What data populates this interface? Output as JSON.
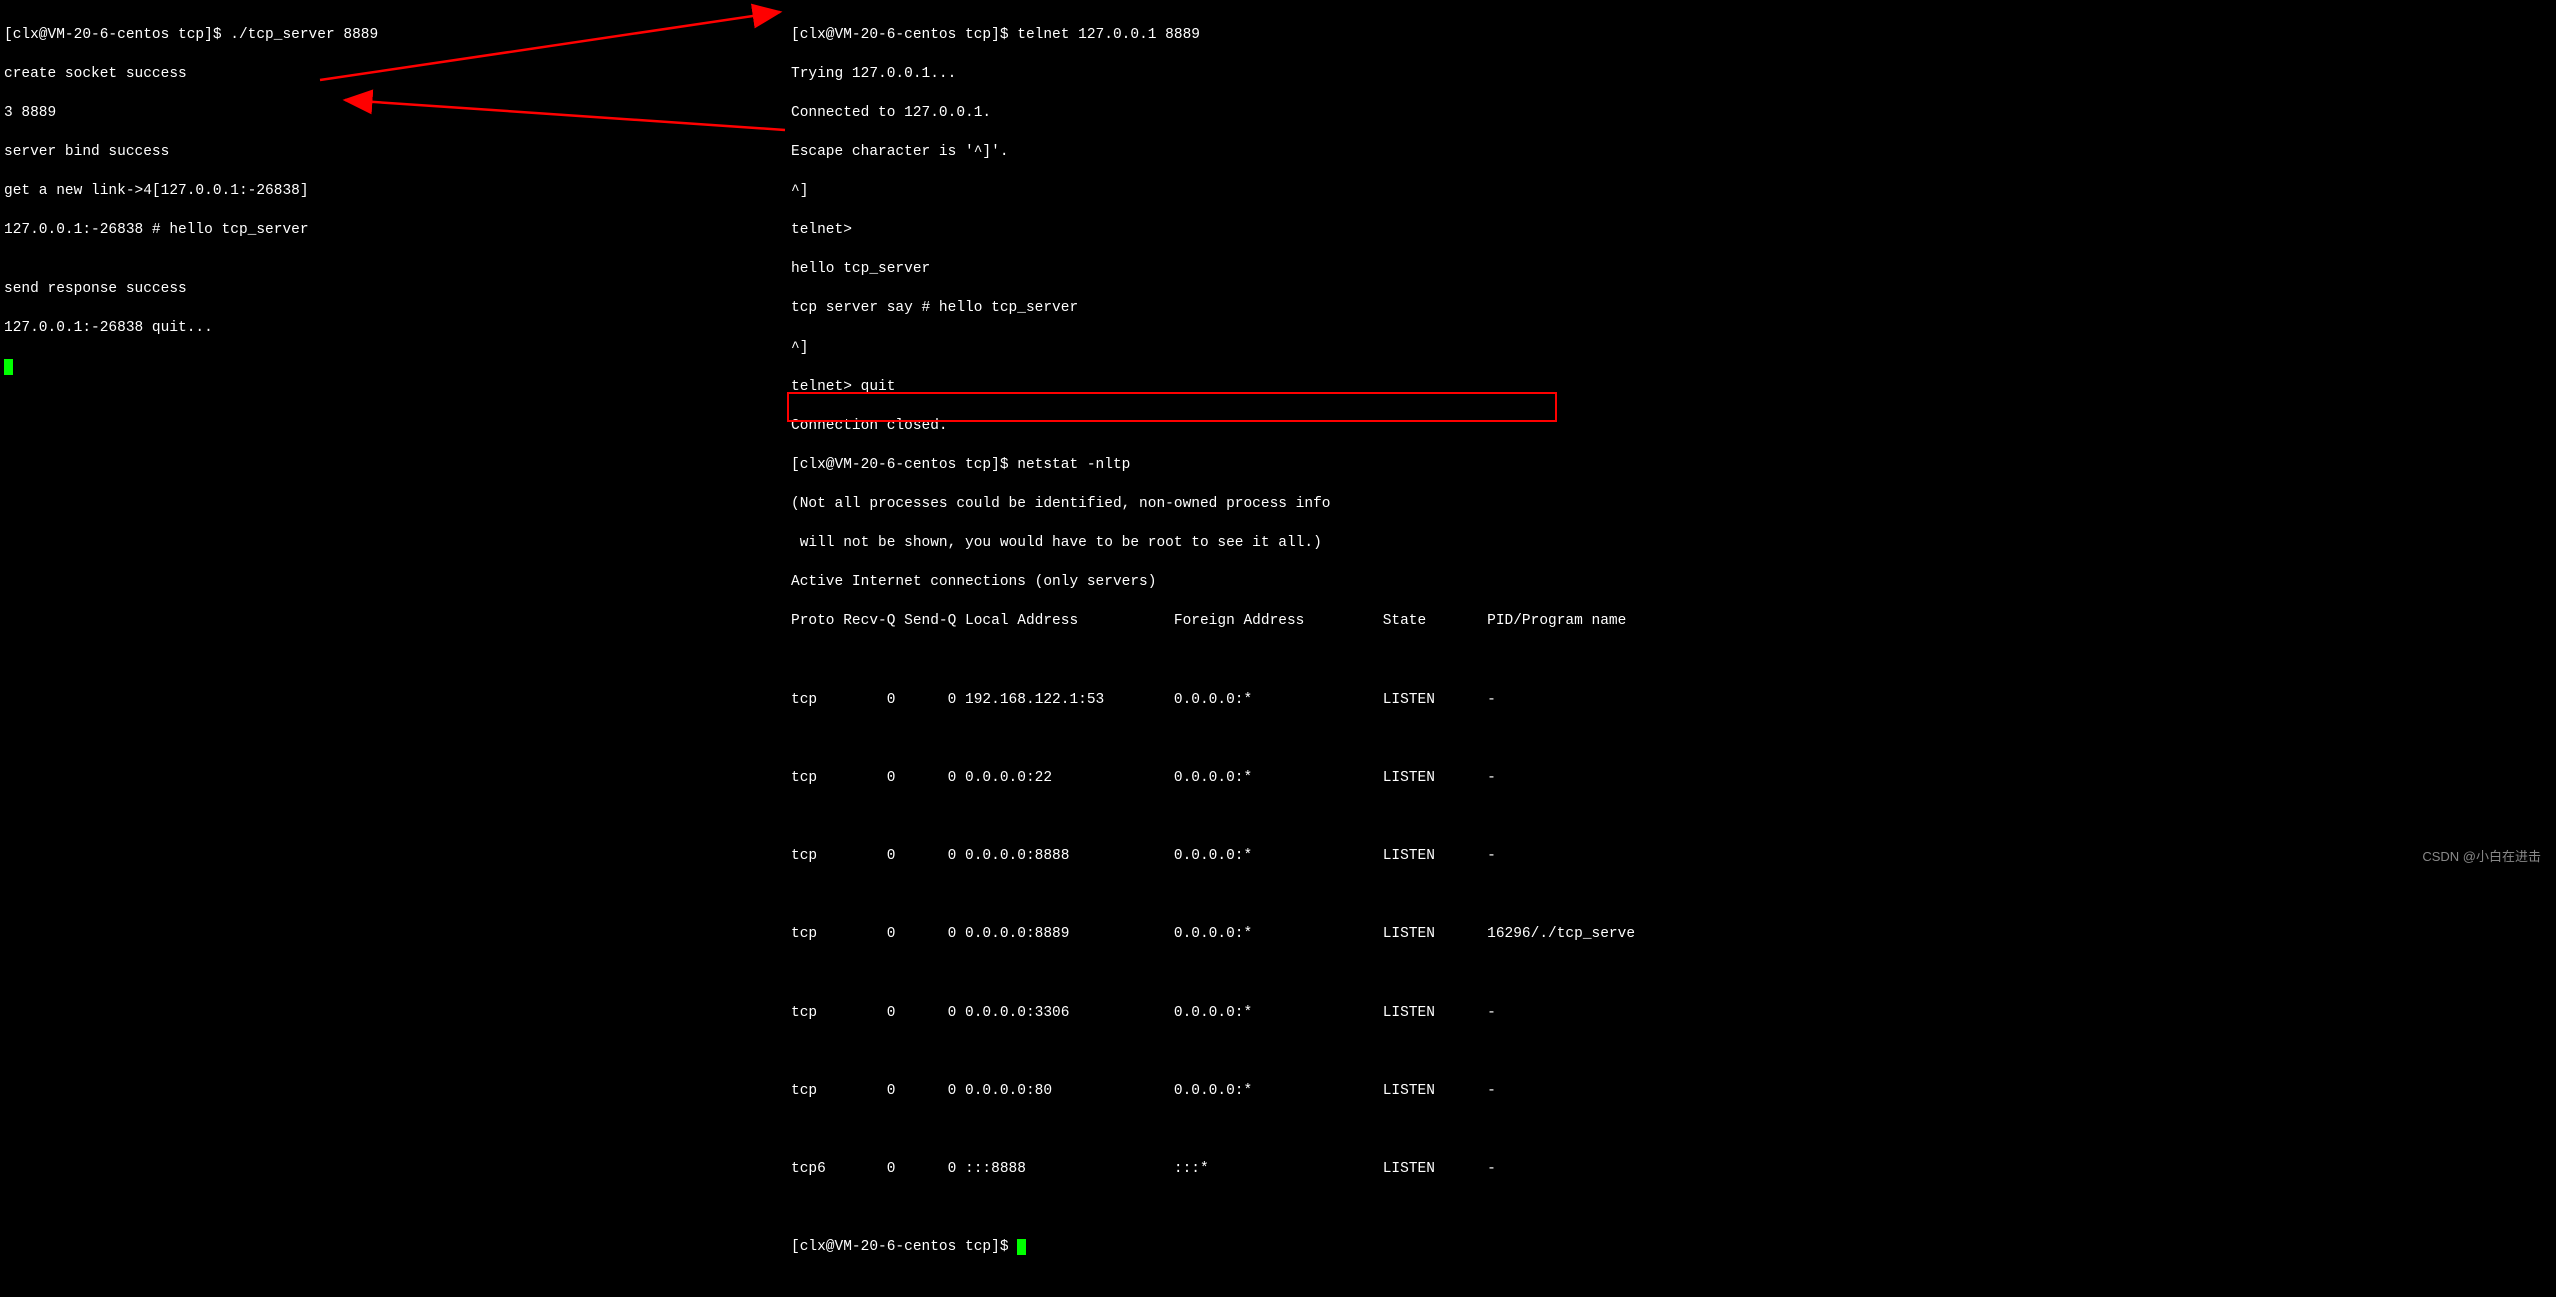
{
  "leftTerminal": {
    "prompt": "[clx@VM-20-6-centos tcp]$",
    "command": " ./tcp_server 8889",
    "lines": {
      "l1": "create socket success",
      "l2": "3 8889",
      "l3": "server bind success",
      "l4": "get a new link->4[127.0.0.1:-26838]",
      "l5": "127.0.0.1:-26838 # hello tcp_server",
      "l6": "",
      "l7": "send response success",
      "l8": "127.0.0.1:-26838 quit..."
    }
  },
  "rightTerminal": {
    "prompt1": "[clx@VM-20-6-centos tcp]$",
    "command1": " telnet 127.0.0.1 8889",
    "lines": {
      "r1": "Trying 127.0.0.1...",
      "r2": "Connected to 127.0.0.1.",
      "r3": "Escape character is '^]'.",
      "r4": "^]",
      "r5": "telnet>",
      "r6": "hello tcp_server",
      "r7": "tcp server say # hello tcp_server",
      "r8": "^]",
      "r9": "telnet> quit",
      "r10": "Connection closed."
    },
    "prompt2": "[clx@VM-20-6-centos tcp]$",
    "command2": " netstat -nltp",
    "netstatInfo": {
      "n1": "(Not all processes could be identified, non-owned process info",
      "n2": " will not be shown, you would have to be root to see it all.)",
      "n3": "Active Internet connections (only servers)"
    },
    "netstatHeader": "Proto Recv-Q Send-Q Local Address           Foreign Address         State       PID/Program name    ",
    "netstatRows": {
      "row0": "tcp        0      0 192.168.122.1:53        0.0.0.0:*               LISTEN      -                   ",
      "row1": "tcp        0      0 0.0.0.0:22              0.0.0.0:*               LISTEN      -                   ",
      "row2": "tcp        0      0 0.0.0.0:8888            0.0.0.0:*               LISTEN      -                   ",
      "row3": "tcp        0      0 0.0.0.0:8889            0.0.0.0:*               LISTEN      16296/./tcp_serve   ",
      "row4": "tcp        0      0 0.0.0.0:3306            0.0.0.0:*               LISTEN      -                   ",
      "row5": "tcp        0      0 0.0.0.0:80              0.0.0.0:*               LISTEN      -                   ",
      "row6": "tcp6       0      0 :::8888                 :::*                    LISTEN      -                   "
    },
    "prompt3": "[clx@VM-20-6-centos tcp]$ "
  },
  "watermark": "CSDN @小白在进击"
}
